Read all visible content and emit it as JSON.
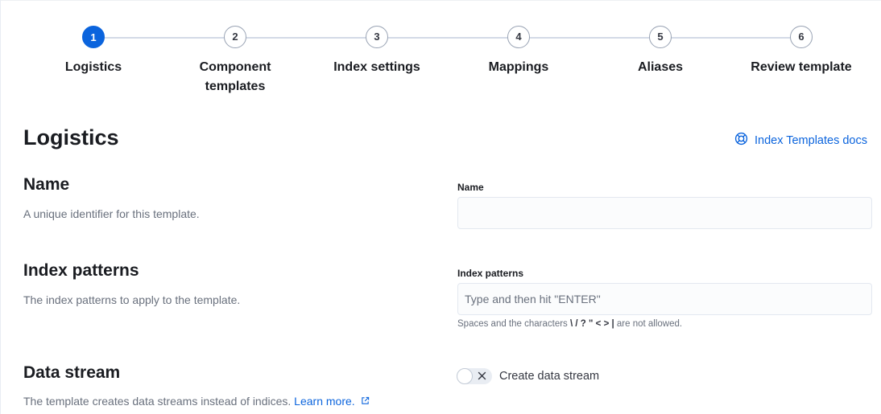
{
  "steps": [
    {
      "number": "1",
      "title": "Logistics",
      "current": true
    },
    {
      "number": "2",
      "title": "Component templates",
      "current": false
    },
    {
      "number": "3",
      "title": "Index settings",
      "current": false
    },
    {
      "number": "4",
      "title": "Mappings",
      "current": false
    },
    {
      "number": "5",
      "title": "Aliases",
      "current": false
    },
    {
      "number": "6",
      "title": "Review template",
      "current": false
    }
  ],
  "page": {
    "title": "Logistics",
    "docs_link": "Index Templates docs"
  },
  "name_section": {
    "title": "Name",
    "description": "A unique identifier for this template.",
    "field_label": "Name",
    "value": ""
  },
  "index_patterns_section": {
    "title": "Index patterns",
    "description": "The index patterns to apply to the template.",
    "field_label": "Index patterns",
    "placeholder": "Type and then hit \"ENTER\"",
    "help_prefix": "Spaces and the characters",
    "help_chars": "\\ / ? \" < > |",
    "help_suffix": "are not allowed."
  },
  "data_stream_section": {
    "title": "Data stream",
    "description": "The template creates data streams instead of indices.",
    "learn_more": "Learn more.",
    "toggle_label": "Create data stream",
    "toggle_on": false
  },
  "colors": {
    "accent": "#0b64dd",
    "text": "#1a1c21",
    "subdued": "#69707d"
  }
}
